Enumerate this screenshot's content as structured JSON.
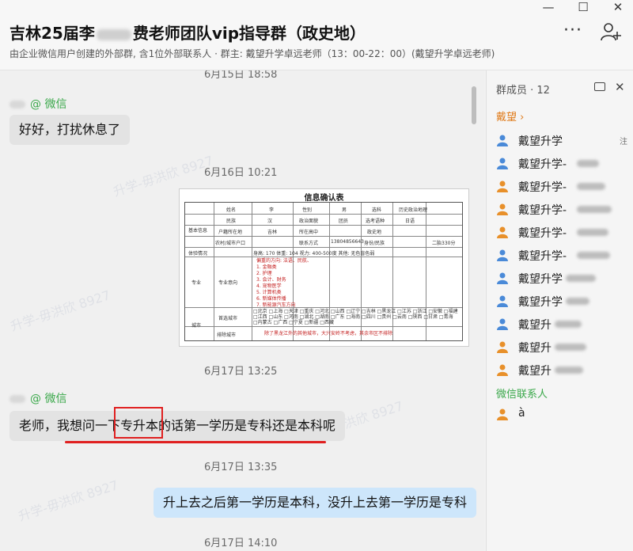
{
  "window": {
    "minimize_glyph": "—",
    "maximize_glyph": "☐",
    "close_glyph": "✕"
  },
  "header": {
    "title": "吉林25届李",
    "title_rest": "费老师团队vip指导群（政史地）",
    "subtitle": "由企业微信用户创建的外部群, 含1位外部联系人 · 群主: 戴望升学卓远老师（13：00-22：00）(戴望升学卓远老师)",
    "more_glyph": "···"
  },
  "chat": {
    "ts_top": "6月15日 18:58",
    "msg1_sender": "@ 微信",
    "msg1_text": "好好，打扰休息了",
    "ts2": "6月16日 10:21",
    "form": {
      "title": "信息确认表",
      "row_labels": [
        "基本信息",
        "",
        "",
        "",
        "体验情况",
        "专业",
        "",
        "城市",
        ""
      ],
      "col_labels": [
        "姓名",
        "民族",
        "户籍所在地",
        "农村/城市户口",
        "李",
        "汉",
        "吉林",
        "",
        "性别",
        "政治面貌",
        "所在高中",
        "联系方式",
        "男",
        "团员",
        "",
        "13804856643",
        "选科",
        "选考语种",
        "政史地",
        "身份/民族",
        "历史政治地理",
        "日语",
        "",
        "二胎330分"
      ],
      "body_line": "身高: 170   体重: 104   视力: 400-500度   其他: 无色盲色弱",
      "major_label": "专业意向",
      "major_lines": [
        "偏重的方向: 法语、民航、",
        "1. 金融类",
        "2. 护理",
        "3. 会计、财务",
        "4. 宠物医学",
        "5. 计算机类",
        "6. 新媒体传播",
        "7. 新能源汽车方向"
      ],
      "city_label": "首选城市",
      "city_line1": "□北京 □上海 □天津 □重庆 □河北 □山西 □辽宁 □吉林 □黑龙江 □江苏 □浙江 □安徽 □福建",
      "city_line2": "□江西 □山东 □河南 □湖北 □湖南 □广东 □海南 □四川 □贵州 □云南 □陕西 □甘肃 □青海",
      "city_line3": "□内蒙古 □广西 □宁夏 □新疆 □西藏",
      "city2_label": "排除城市",
      "city2_note": "除了黑龙江外的其他城市，大兴安岭不考虑，其余市区不排除"
    },
    "ts3": "6月17日 13:25",
    "msg2_sender": "@ 微信",
    "msg2_text": "老师，我想问一下专升本的话第一学历是专科还是本科呢",
    "ts4": "6月17日 13:35",
    "msg3_text": "升上去之后第一学历是本科，没升上去第一学历是专科",
    "ts5": "6月17日 14:10",
    "watermark": "升学-毋洪欣 8927"
  },
  "panel": {
    "header": "群成员 · 12",
    "group_label": "戴望 ›",
    "members": [
      {
        "name": "戴望升学",
        "tag": "注",
        "color": "#4a8ad8"
      },
      {
        "name": "戴望升学-",
        "tag": "",
        "color": "#4a8ad8"
      },
      {
        "name": "戴望升学-",
        "tag": "",
        "color": "#e8902a"
      },
      {
        "name": "戴望升学-",
        "tag": "",
        "color": "#e8902a"
      },
      {
        "name": "戴望升学-",
        "tag": "",
        "color": "#e8902a"
      },
      {
        "name": "戴望升学-",
        "tag": "",
        "color": "#4a8ad8"
      },
      {
        "name": "戴望升学",
        "tag": "",
        "color": "#4a8ad8"
      },
      {
        "name": "戴望升学",
        "tag": "",
        "color": "#4a8ad8"
      },
      {
        "name": "戴望升",
        "tag": "",
        "color": "#4a8ad8"
      },
      {
        "name": "戴望升",
        "tag": "",
        "color": "#e8902a"
      },
      {
        "name": "戴望升",
        "tag": "",
        "color": "#e8902a"
      }
    ],
    "external_label": "微信联系人",
    "external_member": "à",
    "external_color": "#e8902a"
  }
}
